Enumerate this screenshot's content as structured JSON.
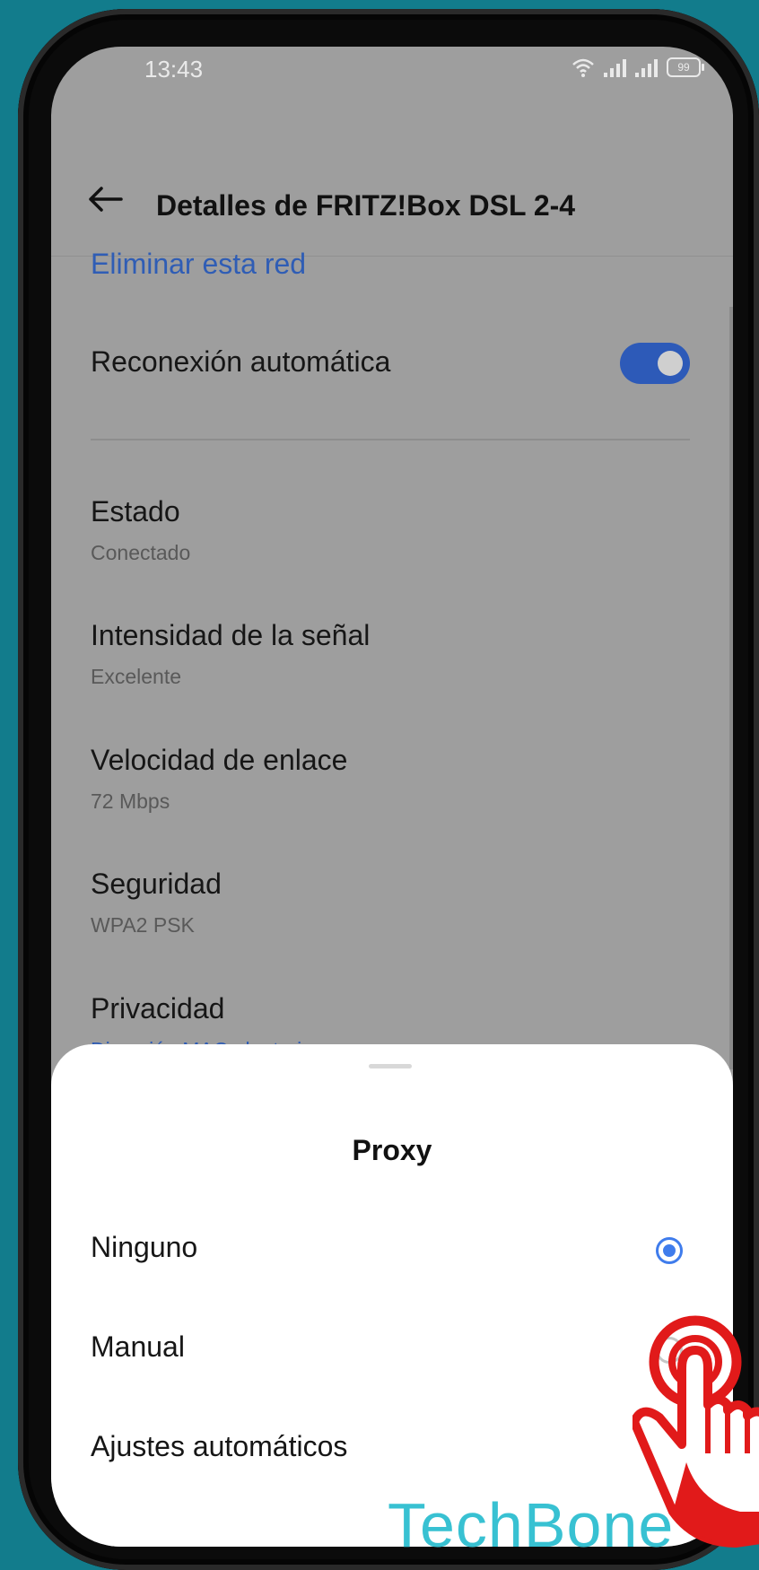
{
  "status_bar": {
    "time": "13:43",
    "battery_level": "99",
    "icons": [
      "wifi-icon",
      "signal-icon",
      "signal-icon",
      "battery-icon"
    ]
  },
  "header": {
    "title": "Detalles de FRITZ!Box DSL 2-4",
    "back_icon": "arrow-left-icon"
  },
  "settings": {
    "remove_network_link": "Eliminar esta red",
    "auto_reconnect": {
      "label": "Reconexión automática",
      "enabled": true
    },
    "items": [
      {
        "title": "Estado",
        "value": "Conectado"
      },
      {
        "title": "Intensidad de la señal",
        "value": "Excelente"
      },
      {
        "title": "Velocidad de enlace",
        "value": "72 Mbps"
      },
      {
        "title": "Seguridad",
        "value": "WPA2 PSK"
      },
      {
        "title": "Privacidad",
        "value": "Dirección MAC aleatoria"
      }
    ]
  },
  "proxy_sheet": {
    "title": "Proxy",
    "options": [
      {
        "label": "Ninguno",
        "selected": true
      },
      {
        "label": "Manual",
        "selected": false
      },
      {
        "label": "Ajustes automáticos",
        "selected": false
      }
    ]
  },
  "watermark": "TechBone",
  "colors": {
    "accent": "#2d5ab8",
    "radio": "#3f7cec",
    "background": "#127c8c",
    "tap_hand": "#e11a1a",
    "watermark": "#38c1d2"
  }
}
